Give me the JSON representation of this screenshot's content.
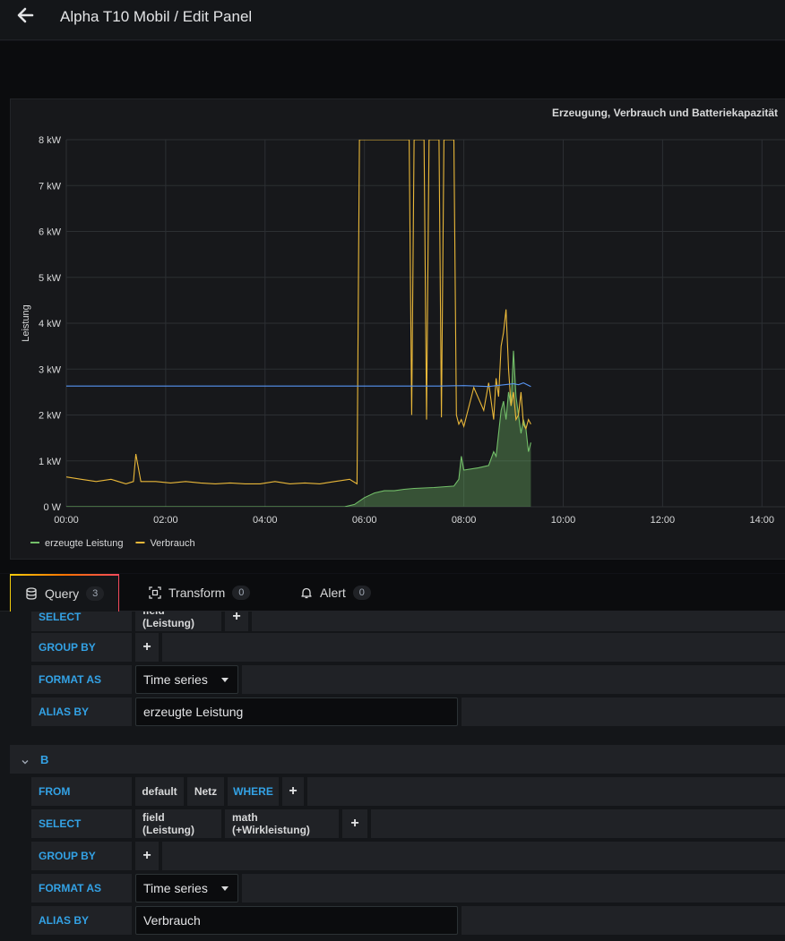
{
  "header": {
    "title": "Alpha T10 Mobil / Edit Panel",
    "back_icon": "arrow-left-icon"
  },
  "panel": {
    "title": "Erzeugung, Verbrauch und Batteriekapazität"
  },
  "chart_data": {
    "type": "line",
    "title": "Erzeugung, Verbrauch und Batteriekapazität",
    "ylabel": "Leistung",
    "xlabel": "",
    "y_ticks": [
      "0 W",
      "1 kW",
      "2 kW",
      "3 kW",
      "4 kW",
      "5 kW",
      "6 kW",
      "7 kW",
      "8 kW"
    ],
    "x_ticks": [
      "00:00",
      "02:00",
      "04:00",
      "06:00",
      "08:00",
      "10:00",
      "12:00",
      "14:00"
    ],
    "ylim": [
      0,
      8
    ],
    "xlim_hours": [
      0,
      14.5
    ],
    "grid": true,
    "legend_position": "bottom-left",
    "series": [
      {
        "name": "erzeugte Leistung",
        "color": "#73bf69",
        "fill": true,
        "x": [
          0,
          5.6,
          5.8,
          6.0,
          6.2,
          6.4,
          6.6,
          6.8,
          7.0,
          7.4,
          7.8,
          7.9,
          7.95,
          8.0,
          8.3,
          8.5,
          8.6,
          8.65,
          8.7,
          8.75,
          8.8,
          8.85,
          8.9,
          8.95,
          9.0,
          9.05,
          9.1,
          9.15,
          9.2,
          9.25,
          9.3,
          9.35
        ],
        "y": [
          0,
          0,
          0.05,
          0.2,
          0.3,
          0.35,
          0.35,
          0.38,
          0.4,
          0.42,
          0.45,
          0.6,
          1.1,
          0.8,
          0.85,
          0.9,
          1.2,
          1.1,
          1.6,
          2.1,
          2.3,
          1.9,
          2.5,
          2.2,
          3.4,
          2.4,
          2.0,
          1.6,
          1.9,
          1.7,
          1.2,
          1.4
        ]
      },
      {
        "name": "Verbrauch",
        "color": "#eab839",
        "fill": false,
        "x": [
          0,
          0.3,
          0.6,
          0.9,
          1.2,
          1.35,
          1.4,
          1.5,
          1.8,
          2.1,
          2.4,
          2.7,
          3.0,
          3.3,
          3.6,
          3.9,
          4.2,
          4.5,
          4.8,
          5.1,
          5.4,
          5.7,
          5.85,
          5.9,
          6.0,
          6.9,
          6.95,
          7.0,
          7.2,
          7.25,
          7.3,
          7.5,
          7.55,
          7.6,
          7.8,
          7.85,
          7.9,
          7.95,
          8.0,
          8.2,
          8.4,
          8.5,
          8.6,
          8.65,
          8.7,
          8.75,
          8.8,
          8.85,
          8.9,
          8.95,
          9.0,
          9.05,
          9.1,
          9.15,
          9.2,
          9.25,
          9.3,
          9.35
        ],
        "y": [
          0.65,
          0.6,
          0.55,
          0.6,
          0.5,
          0.55,
          1.15,
          0.55,
          0.55,
          0.52,
          0.55,
          0.52,
          0.5,
          0.52,
          0.5,
          0.5,
          0.55,
          0.5,
          0.52,
          0.5,
          0.55,
          0.6,
          0.5,
          8,
          8,
          8,
          2.0,
          8,
          8,
          1.9,
          8,
          8,
          1.95,
          8,
          8,
          2.0,
          1.8,
          1.9,
          1.75,
          2.6,
          2.1,
          2.7,
          1.9,
          2.8,
          2.4,
          3.5,
          3.8,
          4.3,
          3.0,
          2.2,
          2.5,
          1.9,
          2.0,
          2.5,
          1.8,
          1.7,
          1.9,
          1.8
        ]
      },
      {
        "name": "",
        "color": "#5794f2",
        "fill": false,
        "x": [
          0,
          6.8,
          7.5,
          8.0,
          8.5,
          9.0,
          9.1,
          9.2,
          9.35
        ],
        "y": [
          2.63,
          2.63,
          2.63,
          2.64,
          2.62,
          2.68,
          2.66,
          2.7,
          2.62
        ]
      }
    ]
  },
  "tabs": [
    {
      "label": "Query",
      "count": "3",
      "icon": "database-icon"
    },
    {
      "label": "Transform",
      "count": "0",
      "icon": "transform-icon"
    },
    {
      "label": "Alert",
      "count": "0",
      "icon": "bell-icon"
    }
  ],
  "query_a": {
    "select_kw": "SELECT",
    "select_field": "field (Leistung)",
    "group_by_kw": "GROUP BY",
    "format_as_kw": "FORMAT AS",
    "format_value": "Time series",
    "alias_by_kw": "ALIAS BY",
    "alias_value": "erzeugte Leistung"
  },
  "query_b": {
    "name": "B",
    "from_kw": "FROM",
    "from_policy": "default",
    "from_measurement": "Netz",
    "where_kw": "WHERE",
    "select_kw": "SELECT",
    "select_field": "field (Leistung)",
    "select_math": "math (+Wirkleistung)",
    "group_by_kw": "GROUP BY",
    "format_as_kw": "FORMAT AS",
    "format_value": "Time series",
    "alias_by_kw": "ALIAS BY",
    "alias_value": "Verbrauch"
  },
  "plus_label": "+"
}
